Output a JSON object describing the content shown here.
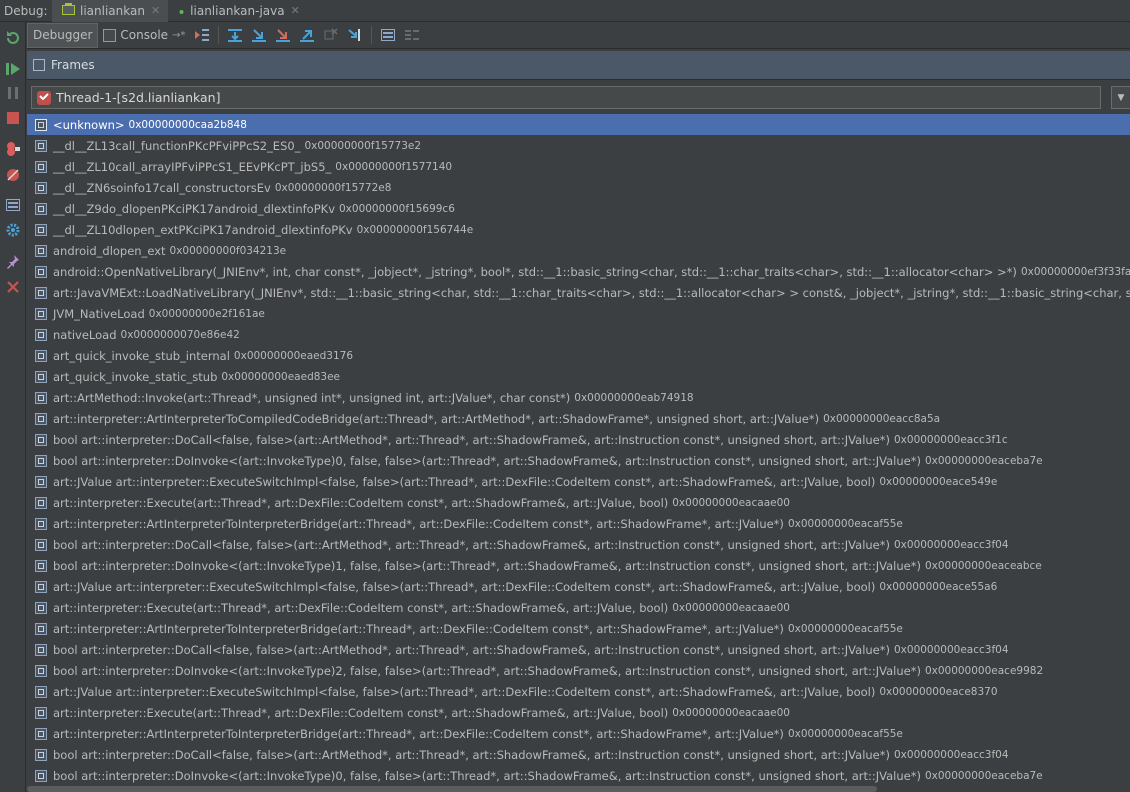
{
  "debug_label": "Debug:",
  "run_tabs": [
    {
      "label": "lianliankan",
      "active": true
    },
    {
      "label": "lianliankan-java",
      "active": false
    }
  ],
  "view_tabs": [
    {
      "label": "Debugger",
      "active": true
    },
    {
      "label": "Console",
      "active": false
    }
  ],
  "frames_title": "Frames",
  "thread_selector": {
    "value": "Thread-1-[s2d.lianliankan]"
  },
  "frames": [
    {
      "name": "<unknown>",
      "addr": "0x00000000caa2b848",
      "selected": true
    },
    {
      "name": "__dl__ZL13call_functionPKcPFviPPcS2_ES0_",
      "addr": "0x00000000f15773e2"
    },
    {
      "name": "__dl__ZL10call_arrayIPFviPPcS1_EEvPKcPT_jbS5_",
      "addr": "0x00000000f1577140"
    },
    {
      "name": "__dl__ZN6soinfo17call_constructorsEv",
      "addr": "0x00000000f15772e8"
    },
    {
      "name": "__dl__Z9do_dlopenPKciPK17android_dlextinfoPKv",
      "addr": "0x00000000f15699c6"
    },
    {
      "name": "__dl__ZL10dlopen_extPKciPK17android_dlextinfoPKv",
      "addr": "0x00000000f156744e"
    },
    {
      "name": "android_dlopen_ext",
      "addr": "0x00000000f034213e"
    },
    {
      "name": "android::OpenNativeLibrary(_JNIEnv*, int, char const*, _jobject*, _jstring*, bool*, std::__1::basic_string<char, std::__1::char_traits<char>, std::__1::allocator<char> >*)",
      "addr": "0x00000000ef3f33fa"
    },
    {
      "name": "art::JavaVMExt::LoadNativeLibrary(_JNIEnv*, std::__1::basic_string<char, std::__1::char_traits<char>, std::__1::allocator<char> > const&, _jobject*, _jstring*, std::__1::basic_string<char, std::__",
      "addr": ""
    },
    {
      "name": "JVM_NativeLoad",
      "addr": "0x00000000e2f161ae"
    },
    {
      "name": "nativeLoad",
      "addr": "0x0000000070e86e42"
    },
    {
      "name": "art_quick_invoke_stub_internal",
      "addr": "0x00000000eaed3176"
    },
    {
      "name": "art_quick_invoke_static_stub",
      "addr": "0x00000000eaed83ee"
    },
    {
      "name": "art::ArtMethod::Invoke(art::Thread*, unsigned int*, unsigned int, art::JValue*, char const*)",
      "addr": "0x00000000eab74918"
    },
    {
      "name": "art::interpreter::ArtInterpreterToCompiledCodeBridge(art::Thread*, art::ArtMethod*, art::ShadowFrame*, unsigned short, art::JValue*)",
      "addr": "0x00000000eacc8a5a"
    },
    {
      "name": "bool art::interpreter::DoCall<false, false>(art::ArtMethod*, art::Thread*, art::ShadowFrame&, art::Instruction const*, unsigned short, art::JValue*)",
      "addr": "0x00000000eacc3f1c"
    },
    {
      "name": "bool art::interpreter::DoInvoke<(art::InvokeType)0, false, false>(art::Thread*, art::ShadowFrame&, art::Instruction const*, unsigned short, art::JValue*)",
      "addr": "0x00000000eaceba7e"
    },
    {
      "name": "art::JValue art::interpreter::ExecuteSwitchImpl<false, false>(art::Thread*, art::DexFile::CodeItem const*, art::ShadowFrame&, art::JValue, bool)",
      "addr": "0x00000000eace549e"
    },
    {
      "name": "art::interpreter::Execute(art::Thread*, art::DexFile::CodeItem const*, art::ShadowFrame&, art::JValue, bool)",
      "addr": "0x00000000eacaae00"
    },
    {
      "name": "art::interpreter::ArtInterpreterToInterpreterBridge(art::Thread*, art::DexFile::CodeItem const*, art::ShadowFrame*, art::JValue*)",
      "addr": "0x00000000eacaf55e"
    },
    {
      "name": "bool art::interpreter::DoCall<false, false>(art::ArtMethod*, art::Thread*, art::ShadowFrame&, art::Instruction const*, unsigned short, art::JValue*)",
      "addr": "0x00000000eacc3f04"
    },
    {
      "name": "bool art::interpreter::DoInvoke<(art::InvokeType)1, false, false>(art::Thread*, art::ShadowFrame&, art::Instruction const*, unsigned short, art::JValue*)",
      "addr": "0x00000000eaceabce"
    },
    {
      "name": "art::JValue art::interpreter::ExecuteSwitchImpl<false, false>(art::Thread*, art::DexFile::CodeItem const*, art::ShadowFrame&, art::JValue, bool)",
      "addr": "0x00000000eace55a6"
    },
    {
      "name": "art::interpreter::Execute(art::Thread*, art::DexFile::CodeItem const*, art::ShadowFrame&, art::JValue, bool)",
      "addr": "0x00000000eacaae00"
    },
    {
      "name": "art::interpreter::ArtInterpreterToInterpreterBridge(art::Thread*, art::DexFile::CodeItem const*, art::ShadowFrame*, art::JValue*)",
      "addr": "0x00000000eacaf55e"
    },
    {
      "name": "bool art::interpreter::DoCall<false, false>(art::ArtMethod*, art::Thread*, art::ShadowFrame&, art::Instruction const*, unsigned short, art::JValue*)",
      "addr": "0x00000000eacc3f04"
    },
    {
      "name": "bool art::interpreter::DoInvoke<(art::InvokeType)2, false, false>(art::Thread*, art::ShadowFrame&, art::Instruction const*, unsigned short, art::JValue*)",
      "addr": "0x00000000eace9982"
    },
    {
      "name": "art::JValue art::interpreter::ExecuteSwitchImpl<false, false>(art::Thread*, art::DexFile::CodeItem const*, art::ShadowFrame&, art::JValue, bool)",
      "addr": "0x00000000eace8370"
    },
    {
      "name": "art::interpreter::Execute(art::Thread*, art::DexFile::CodeItem const*, art::ShadowFrame&, art::JValue, bool)",
      "addr": "0x00000000eacaae00"
    },
    {
      "name": "art::interpreter::ArtInterpreterToInterpreterBridge(art::Thread*, art::DexFile::CodeItem const*, art::ShadowFrame*, art::JValue*)",
      "addr": "0x00000000eacaf55e"
    },
    {
      "name": "bool art::interpreter::DoCall<false, false>(art::ArtMethod*, art::Thread*, art::ShadowFrame&, art::Instruction const*, unsigned short, art::JValue*)",
      "addr": "0x00000000eacc3f04"
    },
    {
      "name": "bool art::interpreter::DoInvoke<(art::InvokeType)0, false, false>(art::Thread*, art::ShadowFrame&, art::Instruction const*, unsigned short, art::JValue*)",
      "addr": "0x00000000eaceba7e"
    }
  ]
}
